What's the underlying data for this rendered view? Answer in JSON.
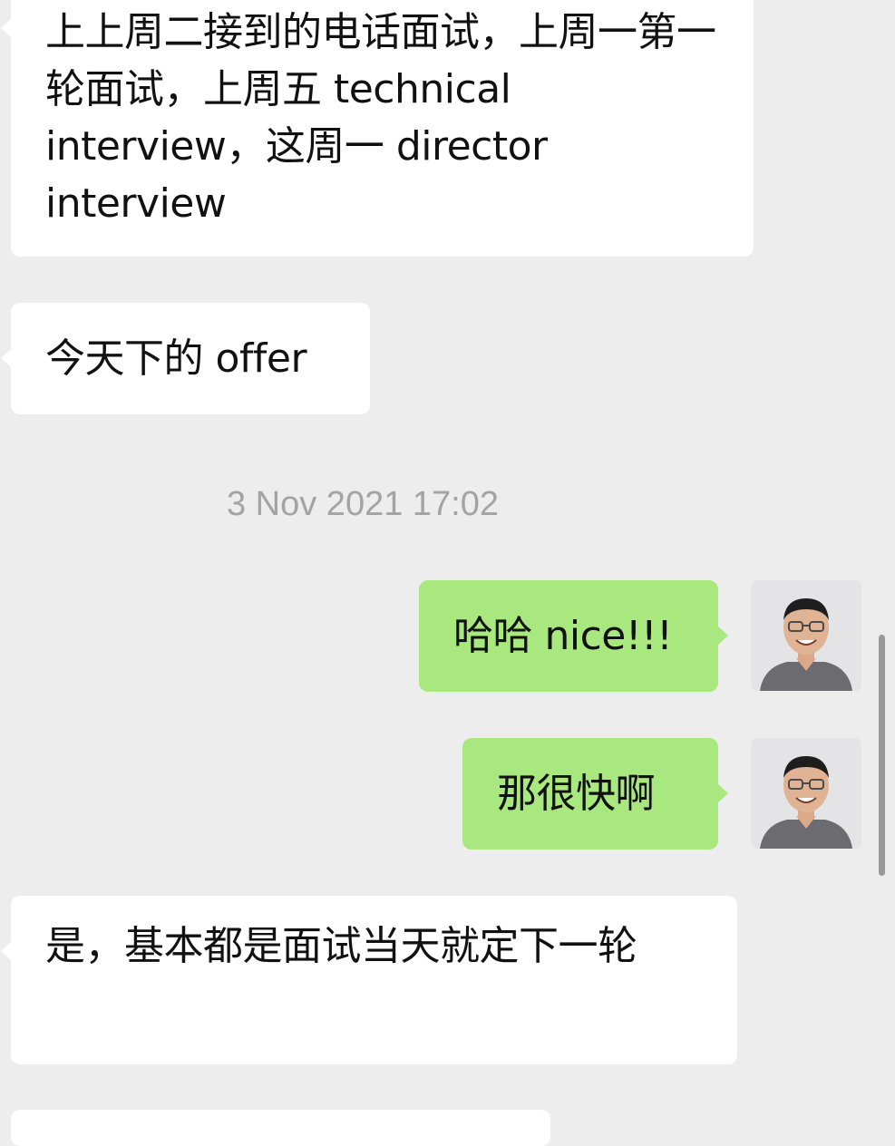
{
  "messages": [
    {
      "direction": "incoming",
      "text": "上上周二接到的电话面试，上周一第一轮面试，上周五 technical interview，这周一 director interview"
    },
    {
      "direction": "incoming",
      "text": "今天下的 offer"
    },
    {
      "direction": "outgoing",
      "text": "哈哈 nice!!!"
    },
    {
      "direction": "outgoing",
      "text": "那很快啊"
    },
    {
      "direction": "incoming",
      "text": "是，基本都是面试当天就定下一轮"
    }
  ],
  "timestamp": "3 Nov 2021 17:02",
  "icons": {
    "avatar": "user-avatar-icon",
    "scrollbar": "scrollbar"
  },
  "colors": {
    "background": "#ededed",
    "incoming_bubble": "#ffffff",
    "outgoing_bubble": "#a9e87f",
    "timestamp": "#a3a3a3"
  }
}
